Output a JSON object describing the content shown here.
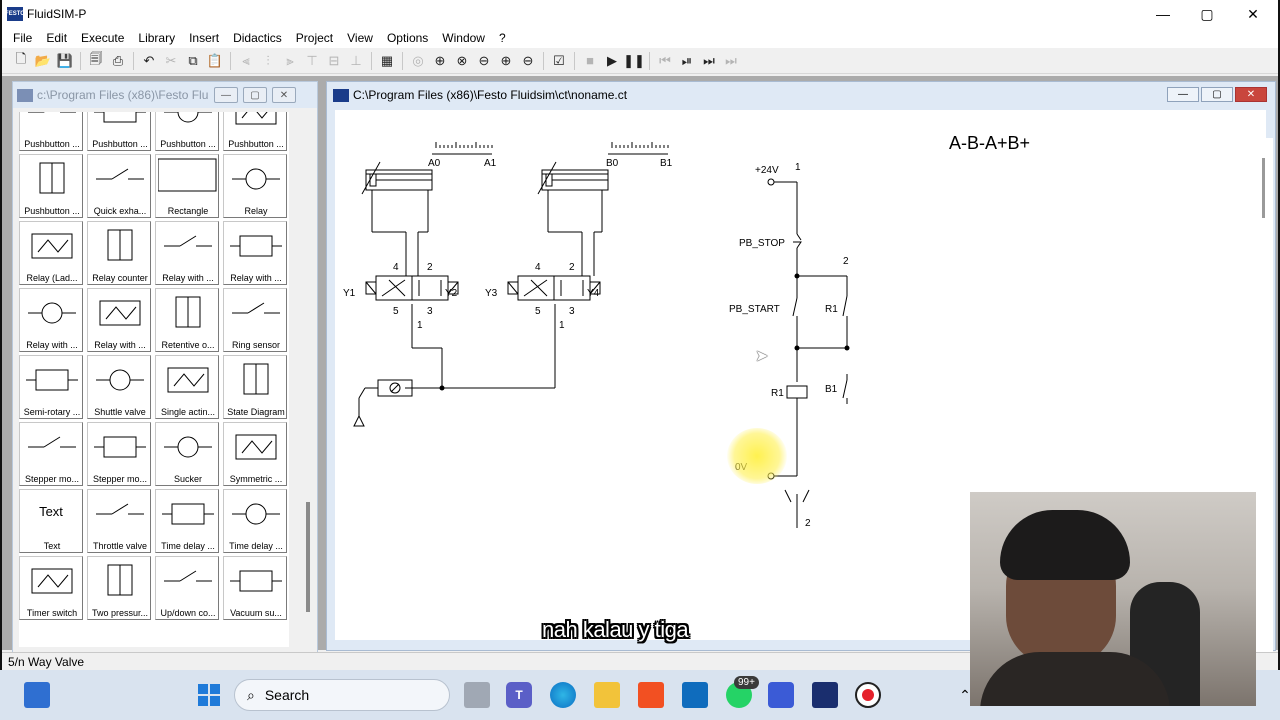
{
  "app": {
    "title": "FluidSIM-P",
    "icon_text": "FESTO"
  },
  "window_controls": {
    "minimize": "—",
    "maximize": "▢",
    "close": "✕"
  },
  "menu": [
    "File",
    "Edit",
    "Execute",
    "Library",
    "Insert",
    "Didactics",
    "Project",
    "View",
    "Options",
    "Window",
    "?"
  ],
  "toolbar": {
    "icons": [
      "new-icon",
      "open-icon",
      "save-icon",
      "print-preview-icon",
      "print-icon",
      "undo-icon",
      "cut-icon",
      "copy-icon",
      "paste-icon",
      "align-left-icon",
      "align-center-icon",
      "align-right-icon",
      "align-top-icon",
      "align-middle-icon",
      "align-bottom-icon",
      "grid-icon",
      "zoom-fit-icon",
      "zoom-window-icon",
      "zoom-page-icon",
      "zoom-icon",
      "zoom-in-icon",
      "zoom-out-icon",
      "check-icon",
      "stop-icon",
      "play-icon",
      "pause-icon",
      "rewind-icon",
      "step-icon",
      "forward-icon",
      "end-icon"
    ]
  },
  "library": {
    "title": "c:\\Program Files (x86)\\Festo Flu...",
    "items": [
      "Pushbutton ...",
      "Pushbutton ...",
      "Pushbutton ...",
      "Pushbutton ...",
      "Pushbutton ...",
      "Quick exha...",
      "Rectangle",
      "Relay",
      "Relay (Lad...",
      "Relay counter",
      "Relay with ...",
      "Relay with ...",
      "Relay with ...",
      "Relay with ...",
      "Retentive o...",
      "Ring sensor",
      "Semi-rotary ...",
      "Shuttle valve",
      "Single actin...",
      "State Diagram",
      "Stepper mo...",
      "Stepper mo...",
      "Sucker",
      "Symmetric ...",
      "Text",
      "Throttle valve",
      "Time delay ...",
      "Time delay ...",
      "Timer switch",
      "Two pressur...",
      "Up/down co...",
      "Vacuum su..."
    ],
    "text_symbol": "Text"
  },
  "circuit": {
    "title": "C:\\Program Files (x86)\\Festo Fluidsim\\ct\\noname.ct",
    "sequence": "A-B-A+B+",
    "pneumatic_labels": {
      "a0": "A0",
      "a1": "A1",
      "b0": "B0",
      "b1": "B1",
      "y1": "Y1",
      "y2": "Y2",
      "y3": "Y3",
      "y4": "Y4",
      "port4": "4",
      "port2": "2",
      "port5": "5",
      "port3": "3",
      "port1": "1"
    },
    "electrical_labels": {
      "v24": "+24V",
      "v0": "0V",
      "line1": "1",
      "line2": "2",
      "pb_stop": "PB_STOP",
      "pb_start": "PB_START",
      "r1": "R1",
      "b1": "B1"
    }
  },
  "status": "5/n Way Valve",
  "subtitle": "nah kalau y tiga",
  "taskbar": {
    "search_label": "Search",
    "badge": "99+",
    "app_icons": [
      "widgets-icon",
      "start-icon",
      "search-icon",
      "task-view-icon",
      "teams-icon",
      "edge-icon",
      "file-explorer-icon",
      "store-icon",
      "mail-icon",
      "whatsapp-icon",
      "vscode-icon",
      "fluidsim-icon",
      "record-icon",
      "tray-chevron-icon"
    ]
  }
}
